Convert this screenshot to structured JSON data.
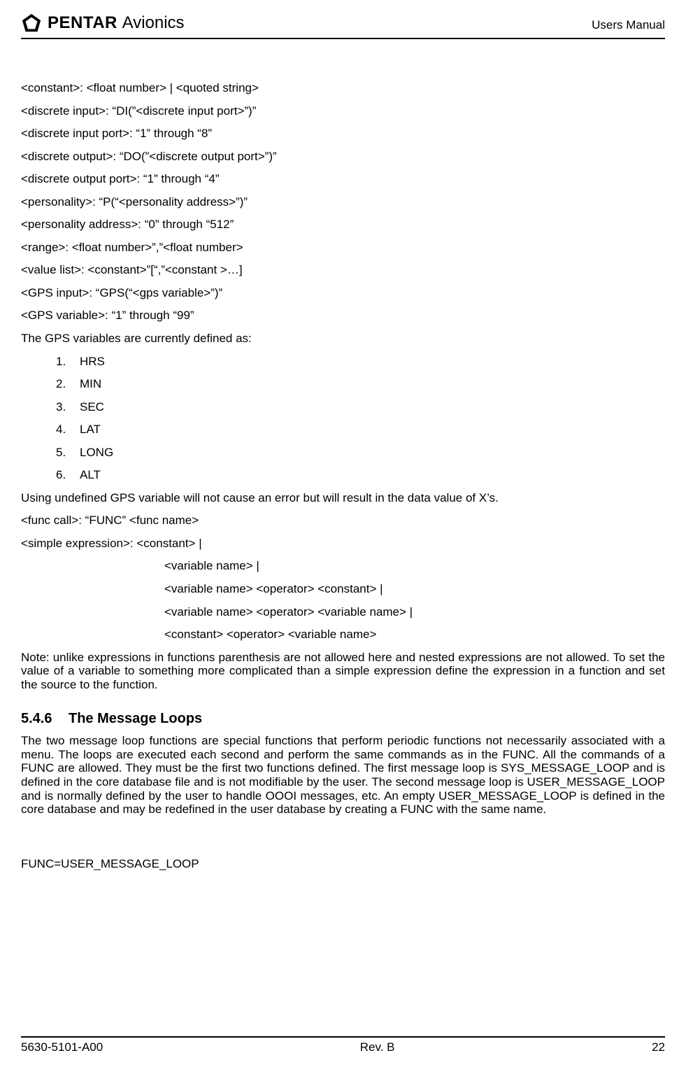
{
  "header": {
    "brand_primary": "PENTAR",
    "brand_secondary": "Avionics",
    "manual_label": "Users Manual"
  },
  "defs": {
    "constant": "<constant>: <float number> | <quoted string>",
    "discrete_input": "<discrete input>: “DI(”<discrete input port>”)”",
    "discrete_input_port": "<discrete input port>: “1” through “8”",
    "discrete_output": "<discrete output>: “DO(”<discrete output port>”)”",
    "discrete_output_port": "<discrete output port>: “1” through “4”",
    "personality": "<personality>: “P(“<personality address>”)”",
    "personality_address": "<personality address>: “0” through “512”",
    "range": "<range>: <float number>”,”<float number>",
    "value_list": "<value list>: <constant>”[“,”<constant >…]",
    "gps_input": "<GPS input>:  “GPS(“<gps variable>”)”",
    "gps_variable": "<GPS variable>: “1” through “99”"
  },
  "gps_vars_intro": "The GPS variables are currently defined as:",
  "gps_vars": {
    "n1": "1.",
    "v1": "HRS",
    "n2": "2.",
    "v2": "MIN",
    "n3": "3.",
    "v3": "SEC",
    "n4": "4.",
    "v4": "LAT",
    "n5": "5.",
    "v5": "LONG",
    "n6": "6.",
    "v6": "ALT"
  },
  "gps_note": "Using undefined GPS variable will not cause an error but will result in the data value of X’s.",
  "func_call": "<func call>: “FUNC” <func name>",
  "simple_expr_lead": "<simple expression>: <constant> |",
  "simple_expr": {
    "l1": "<variable name> |",
    "l2": "<variable name> <operator> <constant> |",
    "l3": "<variable name> <operator> <variable name> |",
    "l4": "<constant> <operator> <variable name>"
  },
  "expr_note": "Note: unlike expressions in functions parenthesis are not allowed here and nested expressions are not allowed.  To set the value of a variable to something more complicated than a simple expression define the expression in a function and set the source to the function.",
  "section": {
    "number": "5.4.6",
    "title": "The Message Loops",
    "body": "The two message loop functions are special functions that perform periodic functions not necessarily associated with a menu.  The loops are executed each second and perform the same commands as in the FUNC.  All the commands of a FUNC are allowed.  They must be the first two functions defined.  The first message loop is SYS_MESSAGE_LOOP and is defined in the core database file and is not modifiable by the user.  The second message loop is USER_MESSAGE_LOOP and is normally defined by the user to handle OOOI messages, etc.  An empty USER_MESSAGE_LOOP is defined in the core database and may be redefined in the user database by creating a FUNC with the same name."
  },
  "func_example": "FUNC=USER_MESSAGE_LOOP",
  "footer": {
    "doc_number": "5630-5101-A00",
    "revision": "Rev. B",
    "page": "22"
  }
}
